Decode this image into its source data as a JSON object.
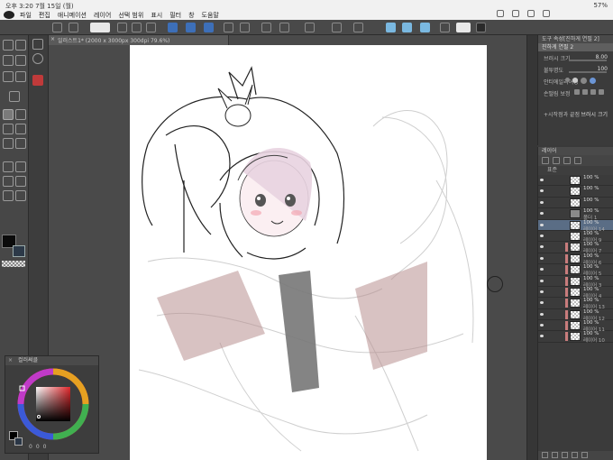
{
  "status": {
    "time": "오후 3:20",
    "date": "7월 15일 (월)",
    "battery": "57%"
  },
  "menu": [
    "파일",
    "편집",
    "애니메이션",
    "레이어",
    "선택 범위",
    "표시",
    "필터",
    "창",
    "도움말"
  ],
  "document": {
    "tab_title": "일러스트1* (2000 x 3000px 300dpi 79.6%)"
  },
  "color_window": {
    "title": "컬러써클",
    "values": [
      "0",
      "0",
      "0"
    ]
  },
  "tool_property": {
    "tab": "도구 속성[진하게 연필 2]",
    "tool_name": "진하게 연필 2",
    "rows": [
      {
        "label": "브러시 크기",
        "value": "8.00"
      },
      {
        "label": "불투명도",
        "value": "100"
      },
      {
        "label": "안티에일리어싱",
        "value": ""
      },
      {
        "label": "손떨림 보정",
        "value": ""
      },
      {
        "label": "+시작점과 끝점",
        "value": "브러시 크기"
      }
    ]
  },
  "layer_panel": {
    "tabs": [
      "레이어"
    ],
    "blend_mode": "표준",
    "layers": [
      {
        "pct": "100 %",
        "name": "",
        "swatch": false,
        "active": false,
        "folder": false
      },
      {
        "pct": "100 %",
        "name": "",
        "swatch": false,
        "active": false,
        "folder": false
      },
      {
        "pct": "100 %",
        "name": "",
        "swatch": false,
        "active": false,
        "folder": false
      },
      {
        "pct": "100 %",
        "name": "폴더 1",
        "swatch": false,
        "active": false,
        "folder": true
      },
      {
        "pct": "100 %",
        "name": "레이어 14",
        "swatch": false,
        "active": true,
        "folder": false
      },
      {
        "pct": "100 %",
        "name": "레이어 9",
        "swatch": false,
        "active": false,
        "folder": false
      },
      {
        "pct": "100 %",
        "name": "레이어 7",
        "swatch": true,
        "active": false,
        "folder": false
      },
      {
        "pct": "100 %",
        "name": "레이어 6",
        "swatch": true,
        "active": false,
        "folder": false
      },
      {
        "pct": "100 %",
        "name": "레이어 5",
        "swatch": true,
        "active": false,
        "folder": false
      },
      {
        "pct": "100 %",
        "name": "레이어 3",
        "swatch": true,
        "active": false,
        "folder": false
      },
      {
        "pct": "100 %",
        "name": "레이어 4",
        "swatch": true,
        "active": false,
        "folder": false
      },
      {
        "pct": "100 %",
        "name": "레이어 13",
        "swatch": true,
        "active": false,
        "folder": false
      },
      {
        "pct": "100 %",
        "name": "레이어 12",
        "swatch": true,
        "active": false,
        "folder": false
      },
      {
        "pct": "100 %",
        "name": "레이어 11",
        "swatch": true,
        "active": false,
        "folder": false
      },
      {
        "pct": "100 %",
        "name": "레이어 10",
        "swatch": true,
        "active": false,
        "folder": false
      }
    ]
  },
  "colors": {
    "accent_blue": "#3d6fb8",
    "active_layer": "#5a6d85",
    "paper": "#ffffff"
  }
}
